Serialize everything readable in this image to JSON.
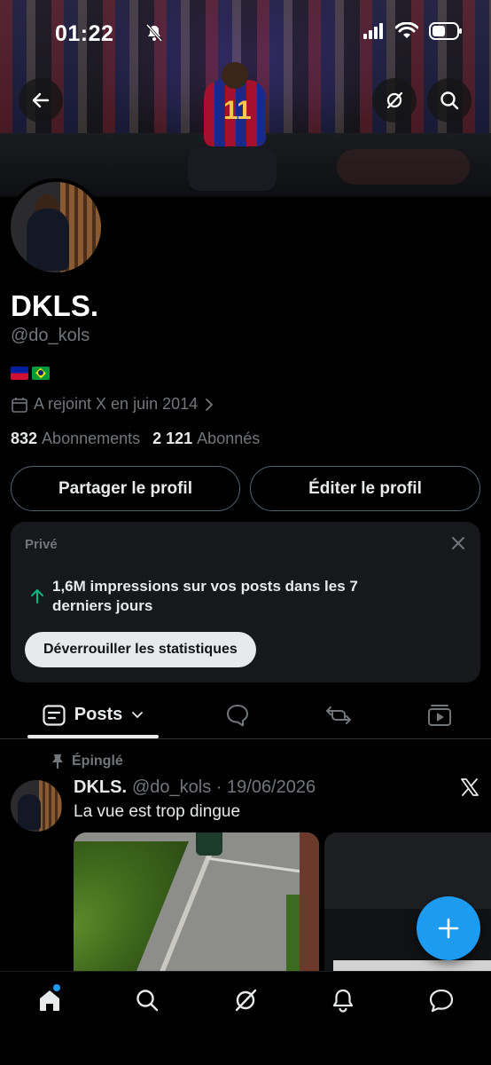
{
  "status_bar": {
    "time": "01:22"
  },
  "profile": {
    "name": "DKLS.",
    "handle": "@do_kols",
    "joined": "A rejoint X en juin 2014",
    "following_count": "832",
    "following_label": "Abonnements",
    "followers_count": "2 121",
    "followers_label": "Abonnés"
  },
  "actions": {
    "share_label": "Partager le profil",
    "edit_label": "Éditer le profil"
  },
  "insights_card": {
    "title": "Privé",
    "text": "1,6M impressions sur vos posts dans les 7 derniers jours",
    "button_label": "Déverrouiller les statistiques",
    "accent_color": "#00ba7c"
  },
  "tabs": {
    "posts_label": "Posts"
  },
  "post": {
    "pinned_label": "Épinglé",
    "author_name": "DKLS.",
    "author_meta": "@do_kols · 19/06/2026",
    "text": "La vue est trop dingue"
  },
  "colors": {
    "accent": "#1d9bf0",
    "background": "#000000",
    "secondary_text": "#71767b"
  },
  "icons": {
    "back": "arrow-left-icon",
    "grok": "grok-icon",
    "search": "search-icon",
    "calendar": "calendar-icon",
    "close": "close-icon",
    "pin": "pin-icon",
    "x_logo": "x-logo-icon",
    "compose": "plus-icon"
  }
}
